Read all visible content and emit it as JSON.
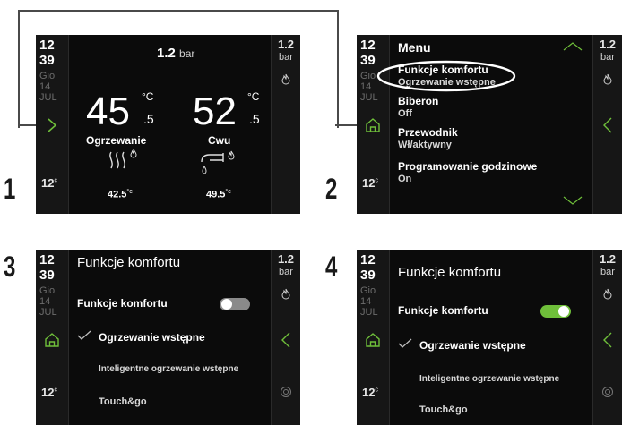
{
  "colors": {
    "accent": "#6fbf3a",
    "panel": "#0b0b0b",
    "bar": "#161616",
    "step": "#1a1a1a"
  },
  "status": {
    "hour": "12",
    "minute": "39",
    "day": "Gio",
    "date": "14",
    "month": "JUL",
    "outdoor_temp": "12",
    "outdoor_unit": "c",
    "pressure": "1.2",
    "pressure_unit": "bar"
  },
  "steps": [
    "1",
    "2",
    "3",
    "4"
  ],
  "screen1": {
    "pressure_value": "1.2",
    "pressure_unit": "bar",
    "heating": {
      "temp": "45",
      "decimal": ".5",
      "unit": "°C",
      "label": "Ogrzewanie",
      "setpoint": "42.5",
      "setpoint_unit": "°c"
    },
    "dhw": {
      "temp": "52",
      "decimal": ".5",
      "unit": "°C",
      "label": "Cwu",
      "setpoint": "49.5",
      "setpoint_unit": "°c"
    }
  },
  "screen2": {
    "title": "Menu",
    "items": [
      {
        "title": "Funkcje komfortu",
        "value": "Ogrzewanie wstępne"
      },
      {
        "title": "Biberon",
        "value": "Off"
      },
      {
        "title": "Przewodnik",
        "value": "Wł/aktywny"
      },
      {
        "title": "Programowanie godzinowe",
        "value": "On"
      }
    ]
  },
  "screen3": {
    "title": "Funkcje komfortu",
    "toggle_label": "Funkcje komfortu",
    "toggle_on": false,
    "options": [
      "Ogrzewanie wstępne",
      "Inteligentne ogrzewanie wstępne",
      "Touch&go"
    ]
  },
  "screen4": {
    "title": "Funkcje komfortu",
    "toggle_label": "Funkcje komfortu",
    "toggle_on": true,
    "options": [
      "Ogrzewanie wstępne",
      "Inteligentne ogrzewanie wstępne",
      "Touch&go"
    ]
  }
}
